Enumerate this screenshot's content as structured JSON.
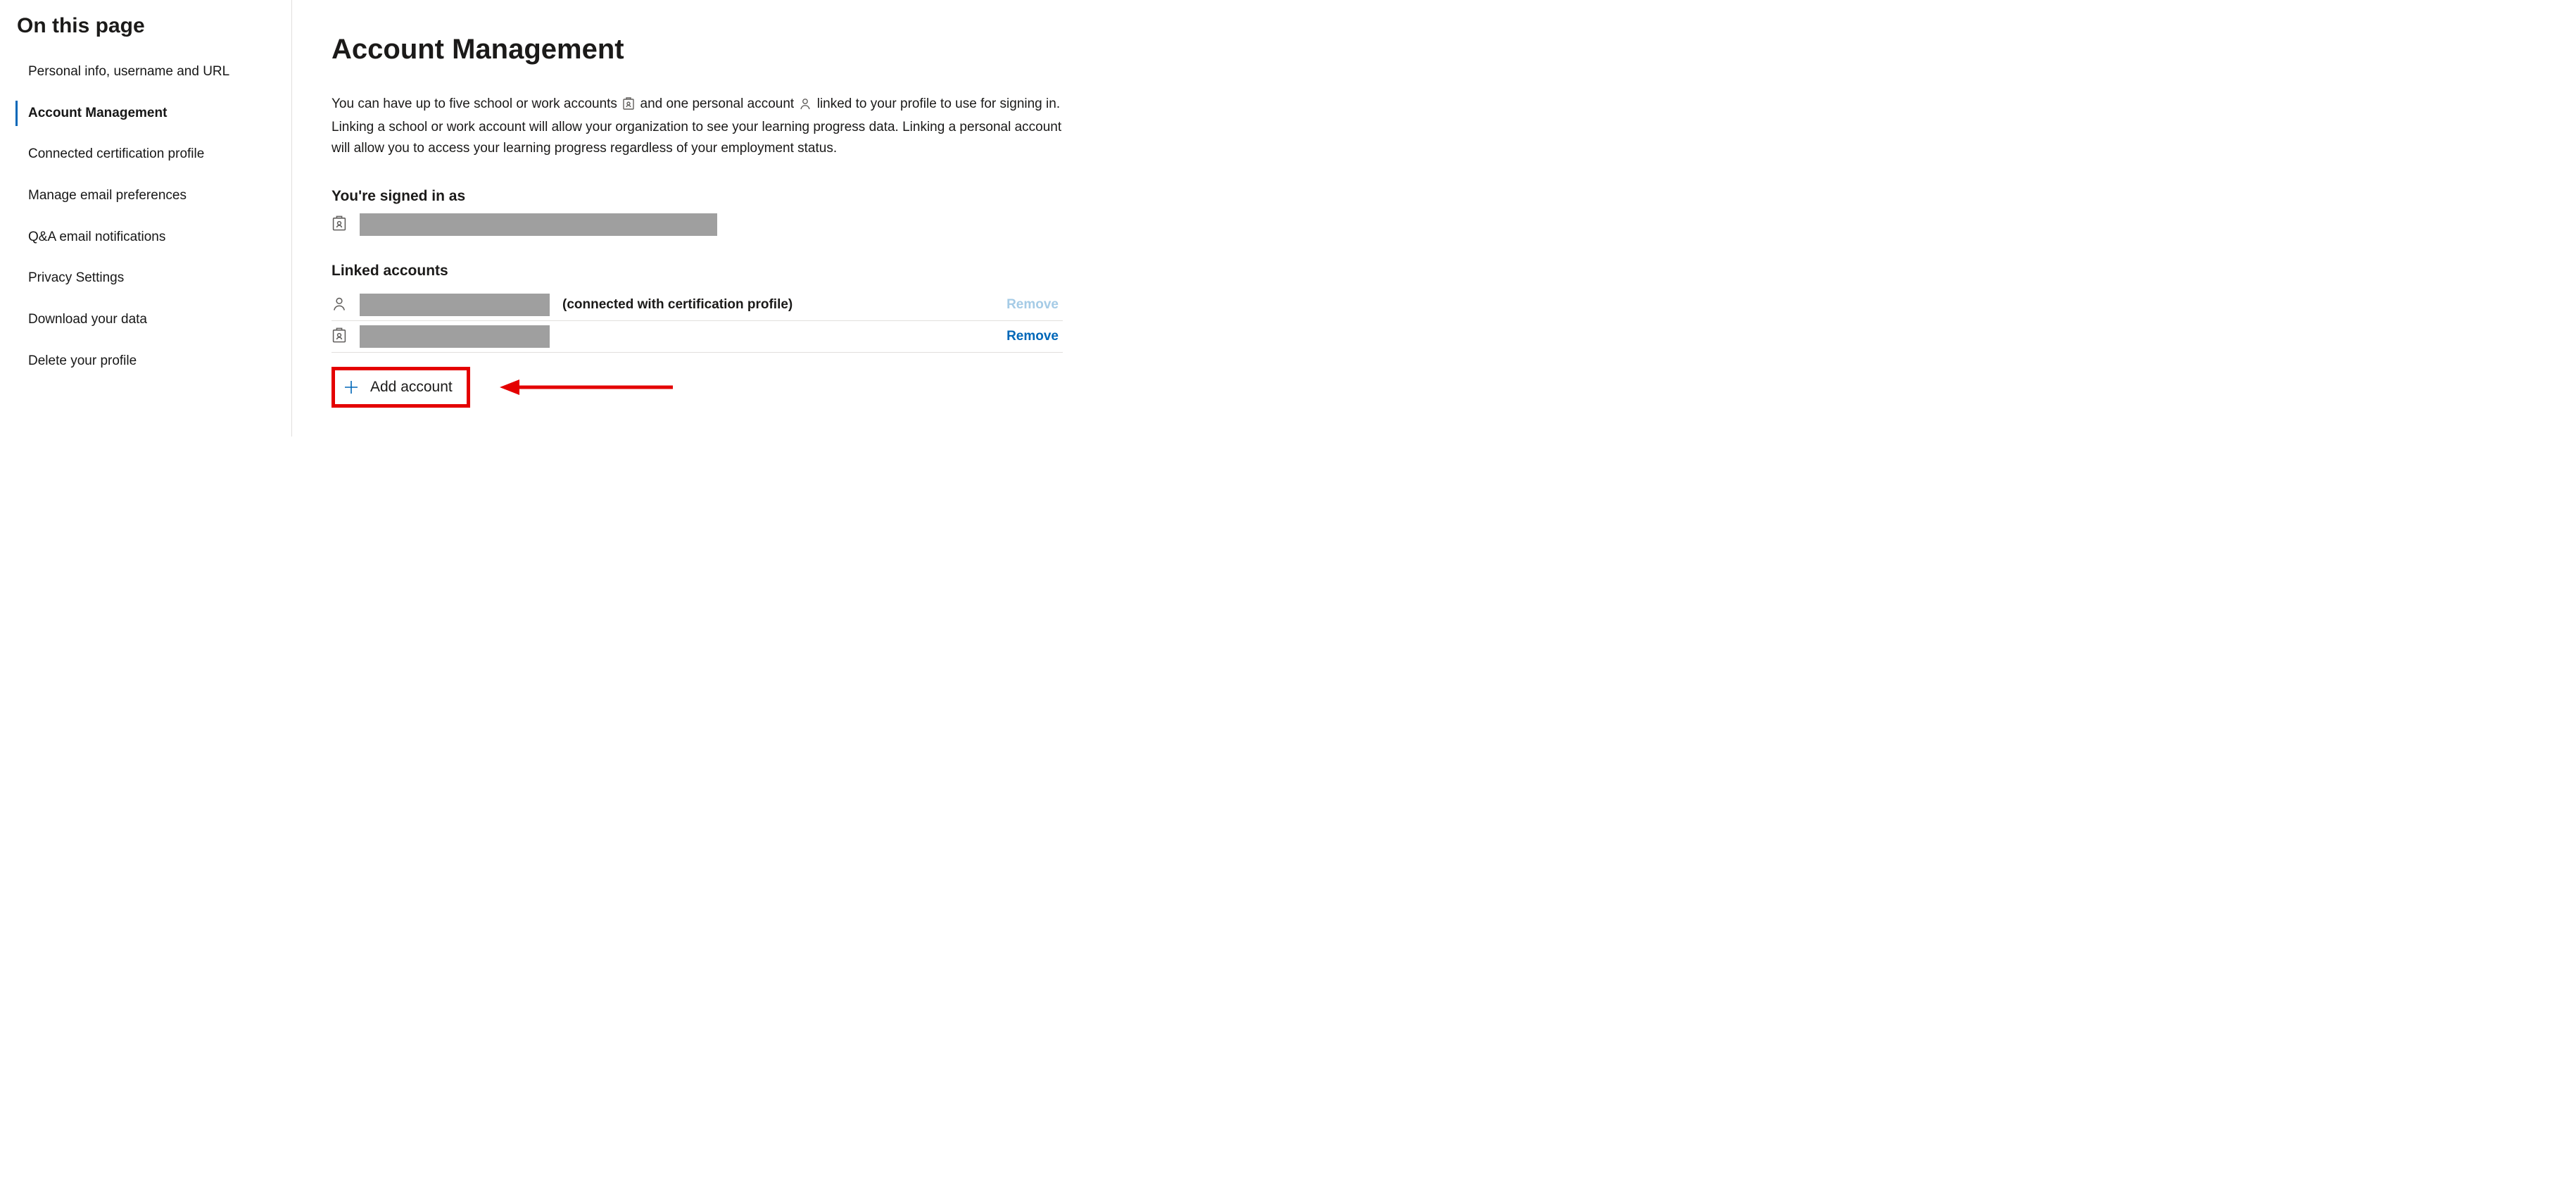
{
  "sidebar": {
    "title": "On this page",
    "items": [
      {
        "label": "Personal info, username and URL",
        "active": false
      },
      {
        "label": "Account Management",
        "active": true
      },
      {
        "label": "Connected certification profile",
        "active": false
      },
      {
        "label": "Manage email preferences",
        "active": false
      },
      {
        "label": "Q&A email notifications",
        "active": false
      },
      {
        "label": "Privacy Settings",
        "active": false
      },
      {
        "label": "Download your data",
        "active": false
      },
      {
        "label": "Delete your profile",
        "active": false
      }
    ]
  },
  "main": {
    "heading": "Account Management",
    "intro_part1": "You can have up to five school or work accounts",
    "intro_part2": "and one personal account",
    "intro_part3": "linked to your profile to use for signing in. Linking a school or work account will allow your organization to see your learning progress data. Linking a personal account will allow you to access your learning progress regardless of your employment status.",
    "signed_in_heading": "You're signed in as",
    "signed_in_account": "",
    "linked_heading": "Linked accounts",
    "linked_accounts": [
      {
        "type": "personal",
        "value": "",
        "suffix": "(connected with certification profile)",
        "remove_label": "Remove",
        "remove_enabled": false
      },
      {
        "type": "work",
        "value": "",
        "suffix": "",
        "remove_label": "Remove",
        "remove_enabled": true
      }
    ],
    "add_account_label": "Add account"
  },
  "icons": {
    "work_account": "work-badge-icon",
    "personal_account": "person-icon",
    "plus": "plus-icon"
  },
  "annotation": {
    "highlight_color": "#e40000",
    "arrow_points_to": "add-account-button"
  }
}
